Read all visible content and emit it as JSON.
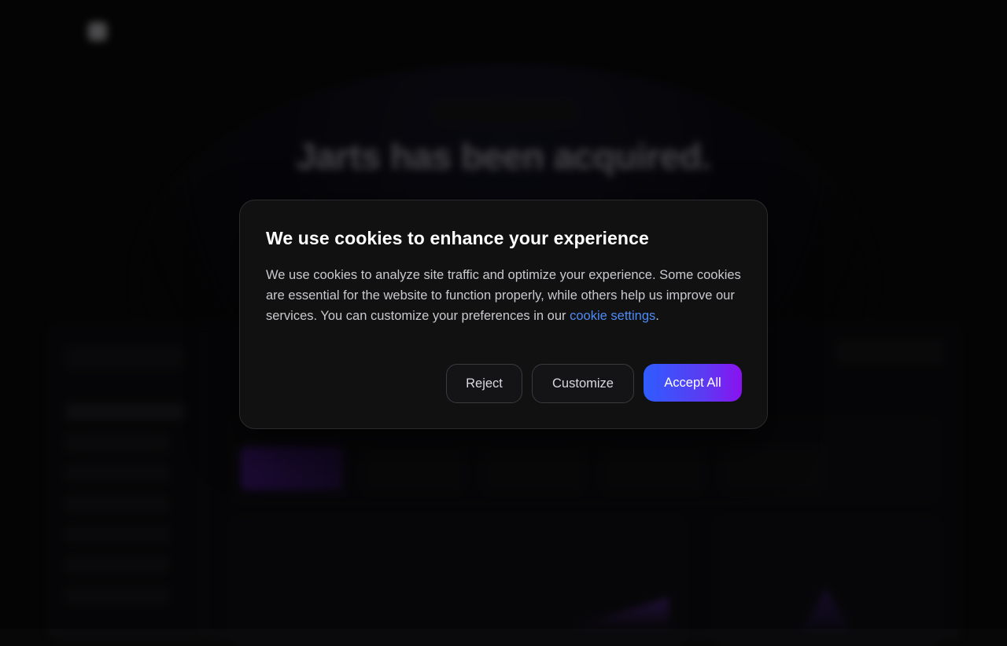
{
  "background": {
    "hero_title": "Jarts has been acquired."
  },
  "cookie_banner": {
    "title": "We use cookies to enhance your experience",
    "body_text": "We use cookies to analyze site traffic and optimize your experience. Some cookies are essential for the website to function properly, while others help us improve our services. You can customize your preferences in our ",
    "link_text": "cookie settings",
    "body_suffix": ".",
    "buttons": {
      "reject": "Reject",
      "customize": "Customize",
      "accept": "Accept All"
    },
    "colors": {
      "link": "#4d8bf5",
      "accept_gradient_start": "#2f5cff",
      "accept_gradient_end": "#8a12f0",
      "dialog_background": "#111112"
    }
  }
}
